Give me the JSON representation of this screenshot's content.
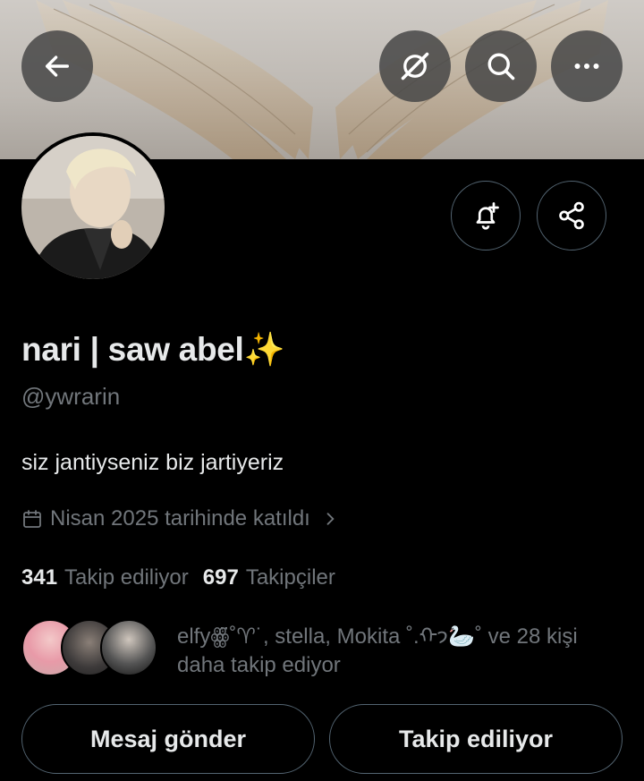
{
  "profile": {
    "display_name": "nari | saw abel✨",
    "handle": "@ywrarin",
    "bio": "siz jantiyseniz biz jartiyeriz",
    "joined": "Nisan 2025 tarihinde katıldı"
  },
  "stats": {
    "following_count": "341",
    "following_label": "Takip ediliyor",
    "followers_count": "697",
    "followers_label": "Takipçiler"
  },
  "followed_by": {
    "text": "elfyꙮ̈˚♈︎˙, stella, Mokita ˚.ᡣ𐭩🦢˚ ve 28 kişi daha takip ediyor"
  },
  "actions": {
    "message_label": "Mesaj gönder",
    "following_label": "Takip ediliyor"
  },
  "icons": {
    "back": "back-arrow-icon",
    "grok": "grok-icon",
    "search": "search-icon",
    "more": "more-icon",
    "notify": "bell-plus-icon",
    "share": "share-icon",
    "calendar": "calendar-icon"
  },
  "colors": {
    "background": "#000000",
    "text_primary": "#e7e9ea",
    "text_secondary": "#71767b",
    "border": "#536471"
  }
}
